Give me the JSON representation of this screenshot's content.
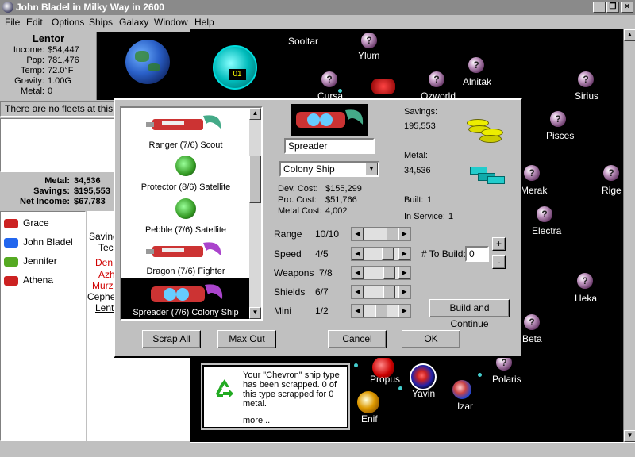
{
  "window": {
    "title": "John Bladel in Milky Way in 2600",
    "controls": [
      "_",
      "❐",
      "×"
    ]
  },
  "menu": [
    "File",
    "Edit",
    "Options",
    "Ships",
    "Galaxy",
    "Window",
    "Help"
  ],
  "planet": {
    "name": "Lentor",
    "income_label": "Income:",
    "income": "$54,447",
    "pop_label": "Pop:",
    "pop": "781,476",
    "temp_label": "Temp:",
    "temp": "72.0°F",
    "gravity_label": "Gravity:",
    "gravity": "1.00G",
    "metal_label": "Metal:",
    "metal": "0"
  },
  "clock": {
    "value": "01"
  },
  "fleets_text": "There are no fleets at this planet",
  "finances": {
    "metal_label": "Metal:",
    "metal": "34,536",
    "savings_label": "Savings:",
    "savings": "$195,553",
    "net_label": "Net Income:",
    "net": "$67,783"
  },
  "players": [
    {
      "name": "Grace",
      "color": "#cc2222"
    },
    {
      "name": "John Bladel",
      "color": "#2266ee"
    },
    {
      "name": "Jennifer",
      "color": "#55aa22"
    },
    {
      "name": "Athena",
      "color": "#cc2222"
    }
  ],
  "side_info": {
    "line1": "Saving",
    "line2": "Tec",
    "red1": "Den",
    "red2": "Azh",
    "red3": "Murzi",
    "line3": "Cephe",
    "link": "Lent"
  },
  "build_dialog": {
    "ships": [
      {
        "label": "Ranger (7/6) Scout"
      },
      {
        "label": "Protector (8/6) Satellite"
      },
      {
        "label": "Pebble (7/6) Satellite"
      },
      {
        "label": "Dragon (7/6) Fighter"
      },
      {
        "label": "Spreader (7/6) Colony Ship",
        "selected": true
      }
    ],
    "ship_name": "Spreader",
    "ship_type": "Colony Ship",
    "dev_cost_label": "Dev. Cost:",
    "dev_cost": "$155,299",
    "pro_cost_label": "Pro. Cost:",
    "pro_cost": "$51,766",
    "metal_cost_label": "Metal Cost:",
    "metal_cost": "4,002",
    "savings_label": "Savings:",
    "savings": "195,553",
    "metal_label": "Metal:",
    "metal": "34,536",
    "built_label": "Built:",
    "built": "1",
    "in_service_label": "In Service:",
    "in_service": "1",
    "sliders": [
      {
        "label": "Range",
        "value": "10/10",
        "level": 1.0
      },
      {
        "label": "Speed",
        "value": "4/5",
        "level": 0.8
      },
      {
        "label": "Weapons",
        "value": "7/8",
        "level": 0.875
      },
      {
        "label": "Shields",
        "value": "6/7",
        "level": 0.857
      },
      {
        "label": "Mini",
        "value": "1/2",
        "level": 0.5
      }
    ],
    "to_build_label": "# To Build:",
    "to_build": "0",
    "plus": "+",
    "minus": "-",
    "build_continue": "Build and Continue",
    "scrap_all": "Scrap All",
    "max_out": "Max Out",
    "cancel": "Cancel",
    "ok": "OK"
  },
  "stars": [
    {
      "name": "Sooltar",
      "kind": "none"
    },
    {
      "name": "Ylum",
      "kind": "q"
    },
    {
      "name": "Alnitak",
      "kind": "q"
    },
    {
      "name": "Ozworld",
      "kind": "q"
    },
    {
      "name": "Cursa",
      "kind": "q"
    },
    {
      "name": "Sirius",
      "kind": "q"
    },
    {
      "name": "Pisces",
      "kind": "q"
    },
    {
      "name": "Merak",
      "kind": "q"
    },
    {
      "name": "Rige",
      "kind": "q"
    },
    {
      "name": "Electra",
      "kind": "q"
    },
    {
      "name": "Heka",
      "kind": "q"
    },
    {
      "name": "Beta",
      "kind": "q"
    },
    {
      "name": "Polaris",
      "kind": "q"
    },
    {
      "name": "Propus",
      "kind": "red"
    },
    {
      "name": "Yavin",
      "kind": "owned"
    },
    {
      "name": "Izar",
      "kind": "blue"
    },
    {
      "name": "Enif",
      "kind": "gold"
    }
  ],
  "message": {
    "text": "Your \"Chevron\" ship type has been scrapped. 0 of this type scrapped for 0 metal.",
    "more": "more..."
  }
}
